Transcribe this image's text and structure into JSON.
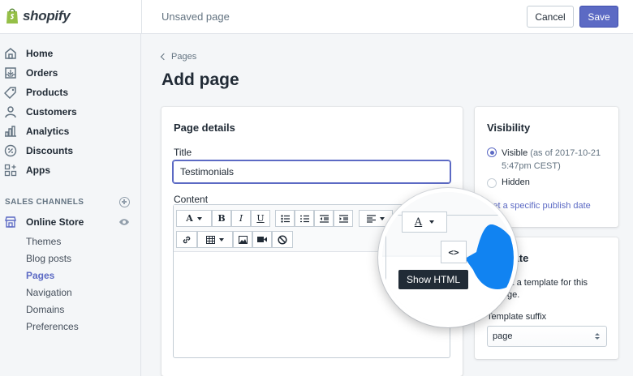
{
  "app": {
    "brand": "shopify",
    "brand_color": "#5c6ac4"
  },
  "topbar": {
    "page_state": "Unsaved page",
    "cancel_label": "Cancel",
    "save_label": "Save"
  },
  "sidebar": {
    "items": [
      {
        "label": "Home",
        "icon": "home-icon"
      },
      {
        "label": "Orders",
        "icon": "orders-icon"
      },
      {
        "label": "Products",
        "icon": "tag-icon"
      },
      {
        "label": "Customers",
        "icon": "person-icon"
      },
      {
        "label": "Analytics",
        "icon": "bar-chart-icon"
      },
      {
        "label": "Discounts",
        "icon": "percent-icon"
      },
      {
        "label": "Apps",
        "icon": "apps-icon"
      }
    ],
    "section_title": "SALES CHANNELS",
    "channel": {
      "label": "Online Store",
      "icon": "store-icon"
    },
    "subitems": [
      "Themes",
      "Blog posts",
      "Pages",
      "Navigation",
      "Domains",
      "Preferences"
    ],
    "active_subitem": "Pages"
  },
  "main": {
    "breadcrumb": "Pages",
    "title": "Add page",
    "details": {
      "heading": "Page details",
      "title_label": "Title",
      "title_value": "Testimonials",
      "content_label": "Content",
      "toolbar": {
        "font_glyph": "A",
        "bold": "B",
        "italic": "I",
        "underline": "U",
        "color_glyph": "A",
        "code_glyph": "<>"
      },
      "tooltip": "Show HTML"
    },
    "visibility": {
      "heading": "Visibility",
      "visible_label": "Visible",
      "visible_meta": "(as of 2017-10-21 5:47pm CEST)",
      "hidden_label": "Hidden",
      "publish_link": "Set a specific publish date"
    },
    "template": {
      "heading_fragment": "plate",
      "desc_line1": "ct a template for this",
      "desc_line2": "ge.",
      "suffix_label": "Template suffix",
      "suffix_value": "page"
    }
  }
}
